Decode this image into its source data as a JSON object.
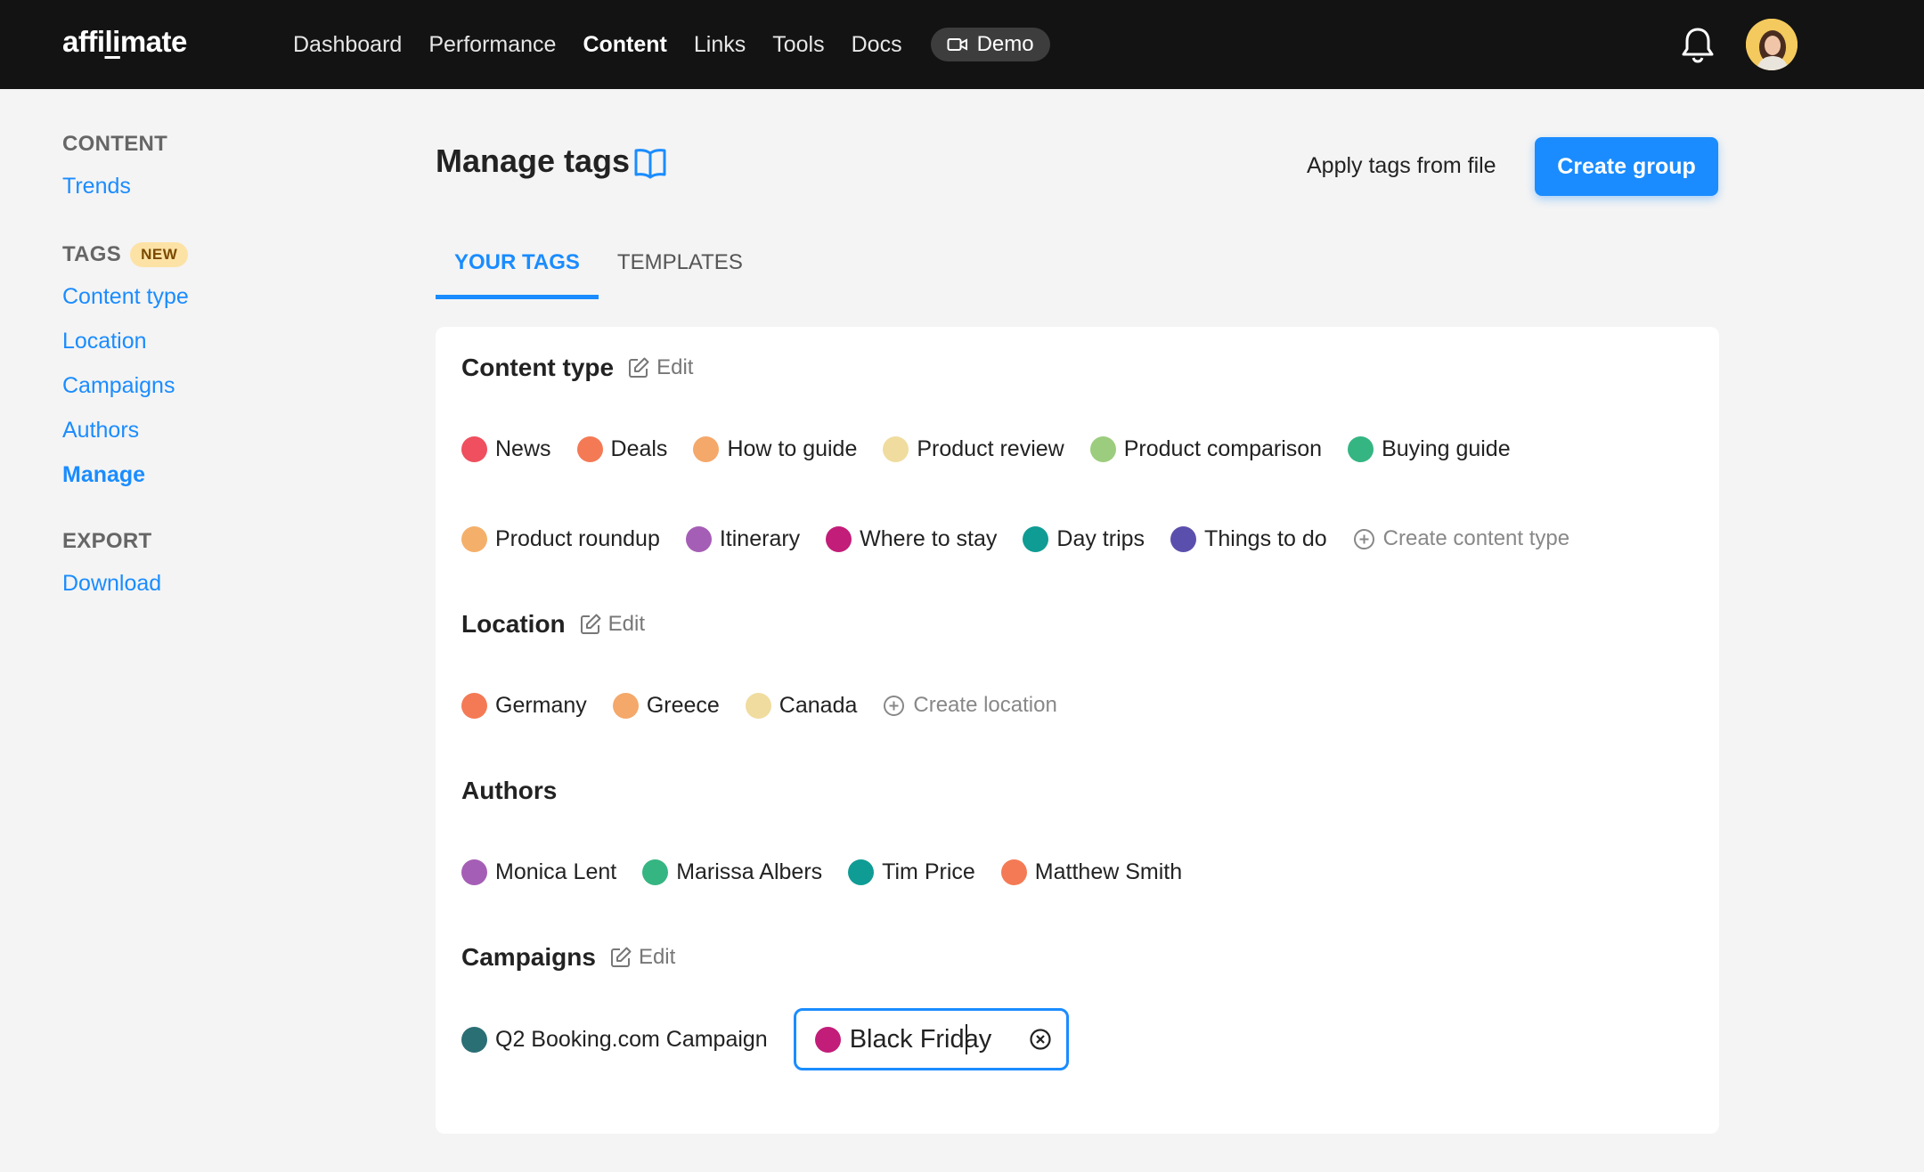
{
  "brand": {
    "name_pre": "affi",
    "name_under": "li",
    "name_post": "mate"
  },
  "nav": {
    "items": [
      "Dashboard",
      "Performance",
      "Content",
      "Links",
      "Tools",
      "Docs"
    ],
    "active": "Content",
    "demo_label": "Demo"
  },
  "sidebar": {
    "content_heading": "CONTENT",
    "content_items": [
      "Trends"
    ],
    "tags_heading": "TAGS",
    "tags_badge": "NEW",
    "tags_items": [
      "Content type",
      "Location",
      "Campaigns",
      "Authors",
      "Manage"
    ],
    "tags_active": "Manage",
    "export_heading": "EXPORT",
    "export_items": [
      "Download"
    ]
  },
  "header": {
    "title": "Manage tags",
    "apply_label": "Apply tags from file",
    "create_label": "Create group"
  },
  "tabs": [
    "YOUR TAGS",
    "TEMPLATES"
  ],
  "sections": {
    "content_type": {
      "title": "Content type",
      "edit_label": "Edit",
      "tags_row1": [
        {
          "label": "News",
          "color": "#ef4f5e"
        },
        {
          "label": "Deals",
          "color": "#f47a55"
        },
        {
          "label": "How to guide",
          "color": "#f4a86a"
        },
        {
          "label": "Product review",
          "color": "#f0dc9e"
        },
        {
          "label": "Product comparison",
          "color": "#9ccd7e"
        },
        {
          "label": "Buying guide",
          "color": "#35b582"
        }
      ],
      "tags_row2": [
        {
          "label": "Product roundup",
          "color": "#f4b06a"
        },
        {
          "label": "Itinerary",
          "color": "#a55eb5"
        },
        {
          "label": "Where to stay",
          "color": "#c21d79"
        },
        {
          "label": "Day trips",
          "color": "#0f9c94"
        },
        {
          "label": "Things to do",
          "color": "#5b4fad"
        }
      ],
      "create_label": "Create content type"
    },
    "location": {
      "title": "Location",
      "edit_label": "Edit",
      "tags": [
        {
          "label": "Germany",
          "color": "#f47a55"
        },
        {
          "label": "Greece",
          "color": "#f4a86a"
        },
        {
          "label": "Canada",
          "color": "#f0dc9e"
        }
      ],
      "create_label": "Create location"
    },
    "authors": {
      "title": "Authors",
      "tags": [
        {
          "label": "Monica Lent",
          "color": "#a55eb5"
        },
        {
          "label": "Marissa Albers",
          "color": "#35b582"
        },
        {
          "label": "Tim Price",
          "color": "#0f9c94"
        },
        {
          "label": "Matthew Smith",
          "color": "#f47a55"
        }
      ]
    },
    "campaigns": {
      "title": "Campaigns",
      "edit_label": "Edit",
      "tags": [
        {
          "label": "Q2 Booking.com Campaign",
          "color": "#2a6f74"
        }
      ],
      "editing": {
        "value": "Black Friday",
        "color": "#c21d79"
      }
    }
  }
}
